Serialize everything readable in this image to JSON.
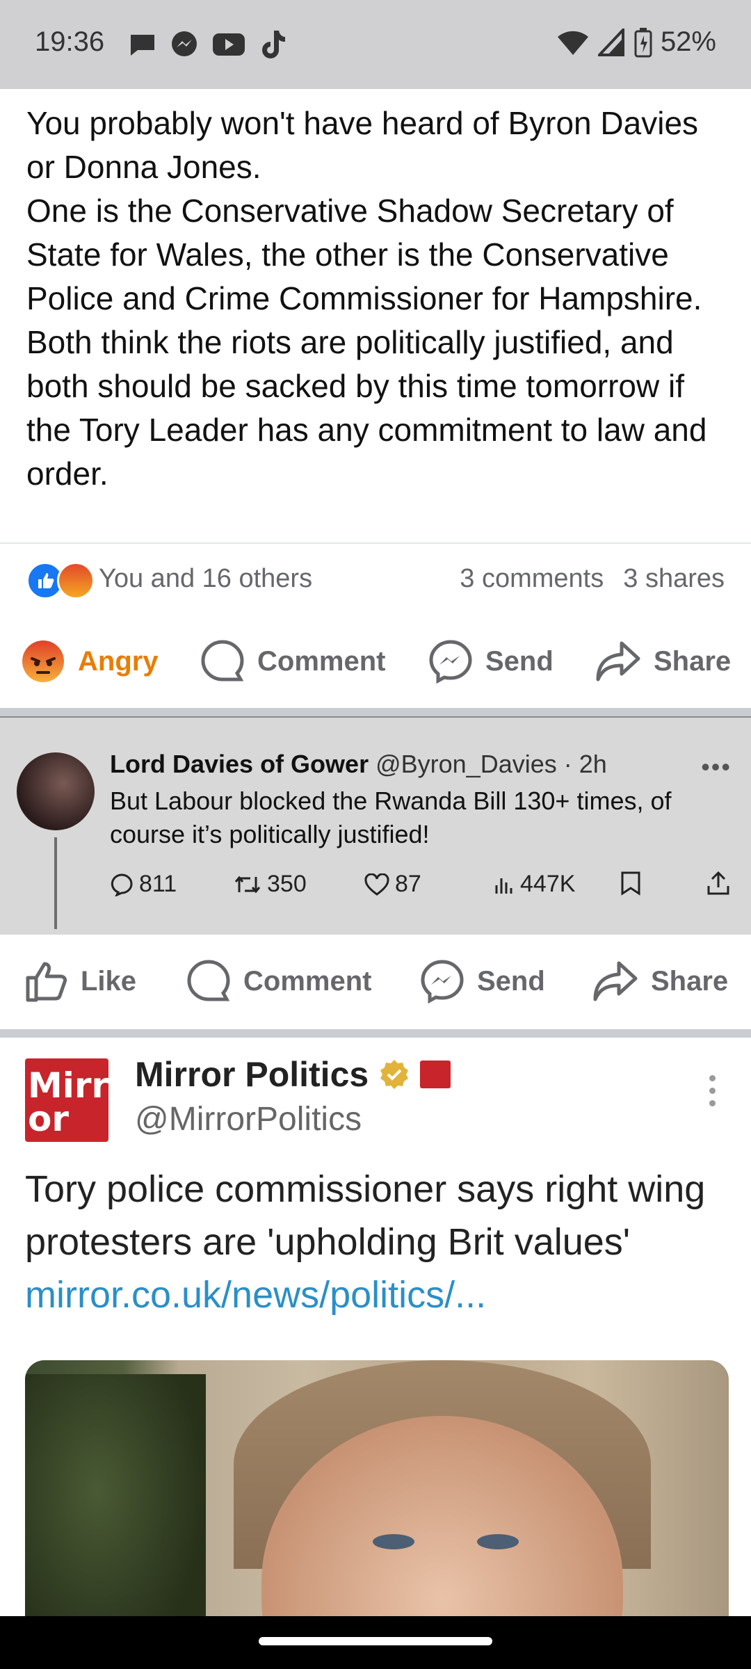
{
  "status_bar": {
    "time": "19:36",
    "battery": "52%",
    "notification_icons": [
      "chat-icon",
      "messenger-icon",
      "youtube-icon",
      "tiktok-icon"
    ]
  },
  "post1": {
    "paragraphs": [
      "You probably won't have heard of Byron Davies or Donna Jones.",
      "One is the Conservative Shadow Secretary of State for Wales, the other is the Conservative Police and Crime Commissioner for Hampshire.",
      "Both think the riots are politically justified, and both should be sacked by this time tomorrow if the Tory Leader has any commitment to law and order."
    ],
    "reactions_text": "You and 16 others",
    "comments": "3 comments",
    "shares": "3 shares",
    "actions": {
      "reaction": "Angry",
      "comment": "Comment",
      "send": "Send",
      "share": "Share"
    }
  },
  "tweet": {
    "name": "Lord Davies of Gower",
    "handle": "@Byron_Davies",
    "time": "· 2h",
    "text": "But Labour blocked the Rwanda Bill 130+ times, of course it’s politically justified!",
    "replies": "811",
    "retweets": "350",
    "likes": "87",
    "views": "447K"
  },
  "post2_actions": {
    "like": "Like",
    "comment": "Comment",
    "send": "Send",
    "share": "Share"
  },
  "mirror_post": {
    "name": "Mirror Politics",
    "handle": "@MirrorPolitics",
    "logo_text": "Mirror",
    "text": "Tory police commissioner says right wing protesters are 'upholding Brit values' ",
    "link": "mirror.co.uk/news/politics/..."
  },
  "colors": {
    "facebook_blue": "#1877f2",
    "angry_orange": "#e87e04",
    "mirror_red": "#c8242b",
    "link_blue": "#2a8fc7"
  }
}
